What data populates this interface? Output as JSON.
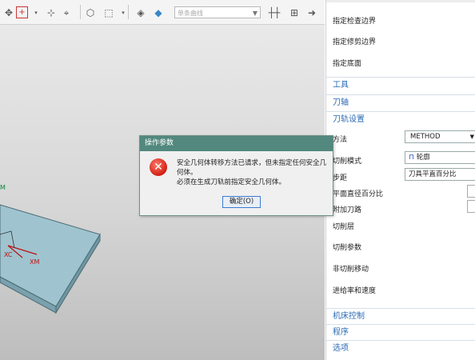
{
  "toolbar": {
    "filter_placeholder": "单条曲线"
  },
  "viewport": {
    "axis_labels": [
      "XC",
      "XM",
      "M"
    ]
  },
  "panel": {
    "top_rows": [
      "指定检查边界",
      "指定修剪边界",
      "指定底面"
    ],
    "sections_a": [
      "工具",
      "刀轴",
      "刀轨设置"
    ],
    "method_label": "方法",
    "method_value": "METHOD",
    "cut_mode_label": "切削模式",
    "cut_mode_value": "轮廓",
    "stepover_label": "步距",
    "stepover_value": "刀具平直百分比",
    "percent_label": "平面直径百分比",
    "passes_label": "附加刀路",
    "rows_b": [
      "切削层",
      "切削参数",
      "非切削移动",
      "进给率和速度"
    ],
    "sections_b": [
      "机床控制",
      "程序",
      "选项"
    ]
  },
  "dialog": {
    "title": "操作参数",
    "message": "安全几何体转移方法已请求，但未指定任何安全几何体。\n必须在生成刀轨前指定安全几何体。",
    "ok_label": "确定(O)"
  }
}
